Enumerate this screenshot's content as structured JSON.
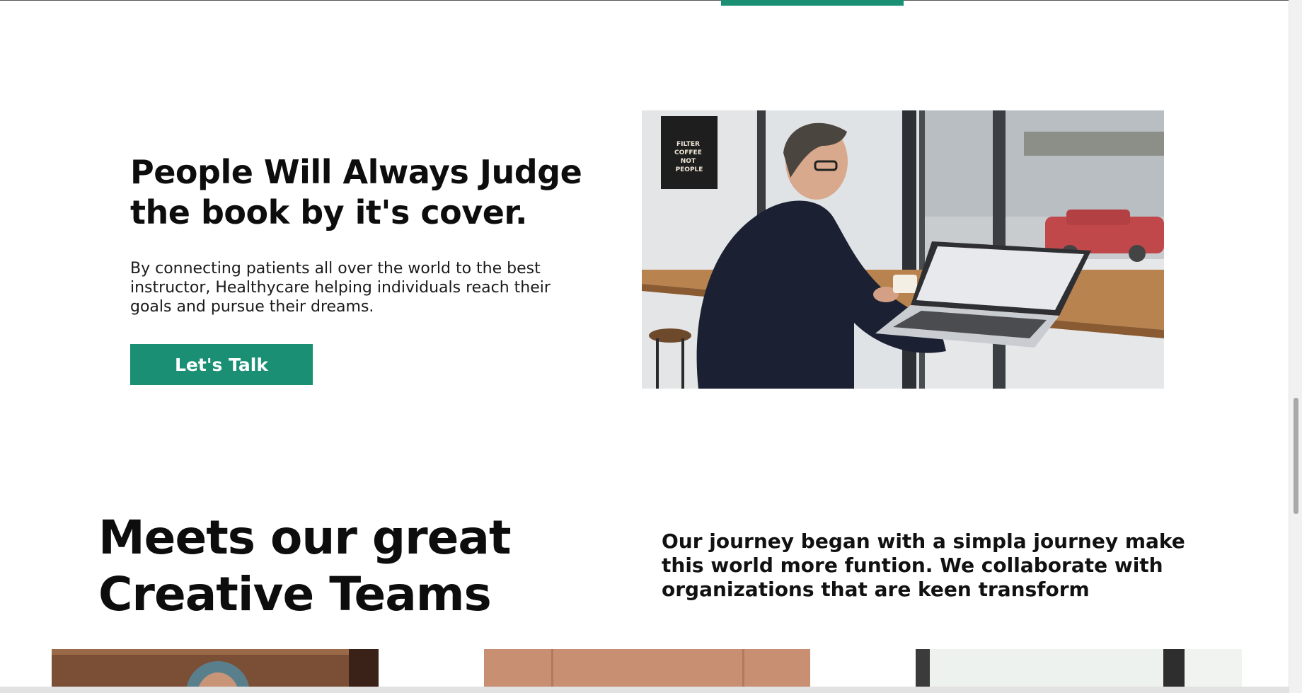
{
  "hero": {
    "heading": "People Will Always Judge the book by it's cover.",
    "text": "By connecting patients all over the world to the best instructor, Healthycare helping individuals reach their goals and pursue their dreams.",
    "cta_label": "Let's Talk",
    "poster_text": "FILTER COFFEE NOT PEOPLE"
  },
  "team": {
    "heading": "Meets our great Creative Teams",
    "intro": "Our journey began with a simpla journey make this world more funtion. We collaborate with organizations that are keen transform"
  },
  "colors": {
    "accent": "#1a8f73",
    "text": "#0d0d0d",
    "background": "#ffffff"
  }
}
